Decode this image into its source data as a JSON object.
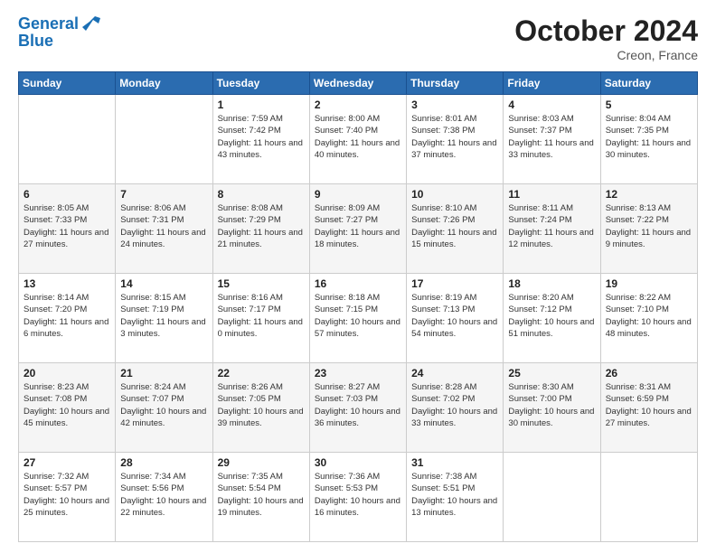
{
  "header": {
    "logo_line1": "General",
    "logo_line2": "Blue",
    "month": "October 2024",
    "location": "Creon, France"
  },
  "days_of_week": [
    "Sunday",
    "Monday",
    "Tuesday",
    "Wednesday",
    "Thursday",
    "Friday",
    "Saturday"
  ],
  "weeks": [
    [
      {
        "day": "",
        "info": ""
      },
      {
        "day": "",
        "info": ""
      },
      {
        "day": "1",
        "info": "Sunrise: 7:59 AM\nSunset: 7:42 PM\nDaylight: 11 hours and 43 minutes."
      },
      {
        "day": "2",
        "info": "Sunrise: 8:00 AM\nSunset: 7:40 PM\nDaylight: 11 hours and 40 minutes."
      },
      {
        "day": "3",
        "info": "Sunrise: 8:01 AM\nSunset: 7:38 PM\nDaylight: 11 hours and 37 minutes."
      },
      {
        "day": "4",
        "info": "Sunrise: 8:03 AM\nSunset: 7:37 PM\nDaylight: 11 hours and 33 minutes."
      },
      {
        "day": "5",
        "info": "Sunrise: 8:04 AM\nSunset: 7:35 PM\nDaylight: 11 hours and 30 minutes."
      }
    ],
    [
      {
        "day": "6",
        "info": "Sunrise: 8:05 AM\nSunset: 7:33 PM\nDaylight: 11 hours and 27 minutes."
      },
      {
        "day": "7",
        "info": "Sunrise: 8:06 AM\nSunset: 7:31 PM\nDaylight: 11 hours and 24 minutes."
      },
      {
        "day": "8",
        "info": "Sunrise: 8:08 AM\nSunset: 7:29 PM\nDaylight: 11 hours and 21 minutes."
      },
      {
        "day": "9",
        "info": "Sunrise: 8:09 AM\nSunset: 7:27 PM\nDaylight: 11 hours and 18 minutes."
      },
      {
        "day": "10",
        "info": "Sunrise: 8:10 AM\nSunset: 7:26 PM\nDaylight: 11 hours and 15 minutes."
      },
      {
        "day": "11",
        "info": "Sunrise: 8:11 AM\nSunset: 7:24 PM\nDaylight: 11 hours and 12 minutes."
      },
      {
        "day": "12",
        "info": "Sunrise: 8:13 AM\nSunset: 7:22 PM\nDaylight: 11 hours and 9 minutes."
      }
    ],
    [
      {
        "day": "13",
        "info": "Sunrise: 8:14 AM\nSunset: 7:20 PM\nDaylight: 11 hours and 6 minutes."
      },
      {
        "day": "14",
        "info": "Sunrise: 8:15 AM\nSunset: 7:19 PM\nDaylight: 11 hours and 3 minutes."
      },
      {
        "day": "15",
        "info": "Sunrise: 8:16 AM\nSunset: 7:17 PM\nDaylight: 11 hours and 0 minutes."
      },
      {
        "day": "16",
        "info": "Sunrise: 8:18 AM\nSunset: 7:15 PM\nDaylight: 10 hours and 57 minutes."
      },
      {
        "day": "17",
        "info": "Sunrise: 8:19 AM\nSunset: 7:13 PM\nDaylight: 10 hours and 54 minutes."
      },
      {
        "day": "18",
        "info": "Sunrise: 8:20 AM\nSunset: 7:12 PM\nDaylight: 10 hours and 51 minutes."
      },
      {
        "day": "19",
        "info": "Sunrise: 8:22 AM\nSunset: 7:10 PM\nDaylight: 10 hours and 48 minutes."
      }
    ],
    [
      {
        "day": "20",
        "info": "Sunrise: 8:23 AM\nSunset: 7:08 PM\nDaylight: 10 hours and 45 minutes."
      },
      {
        "day": "21",
        "info": "Sunrise: 8:24 AM\nSunset: 7:07 PM\nDaylight: 10 hours and 42 minutes."
      },
      {
        "day": "22",
        "info": "Sunrise: 8:26 AM\nSunset: 7:05 PM\nDaylight: 10 hours and 39 minutes."
      },
      {
        "day": "23",
        "info": "Sunrise: 8:27 AM\nSunset: 7:03 PM\nDaylight: 10 hours and 36 minutes."
      },
      {
        "day": "24",
        "info": "Sunrise: 8:28 AM\nSunset: 7:02 PM\nDaylight: 10 hours and 33 minutes."
      },
      {
        "day": "25",
        "info": "Sunrise: 8:30 AM\nSunset: 7:00 PM\nDaylight: 10 hours and 30 minutes."
      },
      {
        "day": "26",
        "info": "Sunrise: 8:31 AM\nSunset: 6:59 PM\nDaylight: 10 hours and 27 minutes."
      }
    ],
    [
      {
        "day": "27",
        "info": "Sunrise: 7:32 AM\nSunset: 5:57 PM\nDaylight: 10 hours and 25 minutes."
      },
      {
        "day": "28",
        "info": "Sunrise: 7:34 AM\nSunset: 5:56 PM\nDaylight: 10 hours and 22 minutes."
      },
      {
        "day": "29",
        "info": "Sunrise: 7:35 AM\nSunset: 5:54 PM\nDaylight: 10 hours and 19 minutes."
      },
      {
        "day": "30",
        "info": "Sunrise: 7:36 AM\nSunset: 5:53 PM\nDaylight: 10 hours and 16 minutes."
      },
      {
        "day": "31",
        "info": "Sunrise: 7:38 AM\nSunset: 5:51 PM\nDaylight: 10 hours and 13 minutes."
      },
      {
        "day": "",
        "info": ""
      },
      {
        "day": "",
        "info": ""
      }
    ]
  ]
}
